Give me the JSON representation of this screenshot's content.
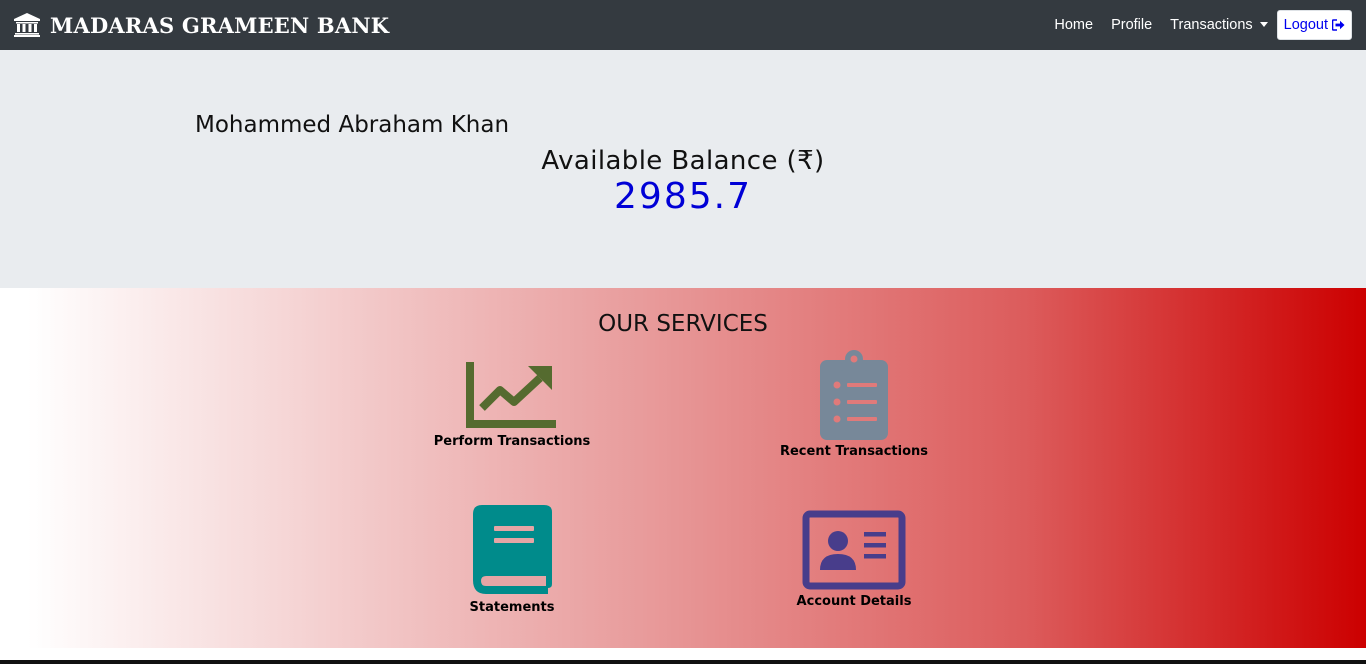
{
  "navbar": {
    "brand_icon": "bank-icon",
    "brand_text": "MADARAS GRAMEEN BANK",
    "links": {
      "home": "Home",
      "profile": "Profile",
      "transactions": "Transactions"
    },
    "logout": "Logout",
    "logout_icon": "sign-out-icon",
    "background": "#343a40"
  },
  "account": {
    "customer_name": "Mohammed Abraham Khan",
    "balance_label": "Available Balance (₹)",
    "balance_value": "2985.7",
    "balance_color": "#0000d6"
  },
  "services": {
    "title": "OUR SERVICES",
    "items": [
      {
        "label": "Perform Transactions",
        "icon": "chart-line-icon",
        "color": "#556b2f"
      },
      {
        "label": "Recent Transactions",
        "icon": "clipboard-list-icon",
        "color": "#778899"
      },
      {
        "label": "Statements",
        "icon": "book-icon",
        "color": "#008b8b"
      },
      {
        "label": "Account Details",
        "icon": "id-card-icon",
        "color": "#483d8b"
      }
    ]
  }
}
